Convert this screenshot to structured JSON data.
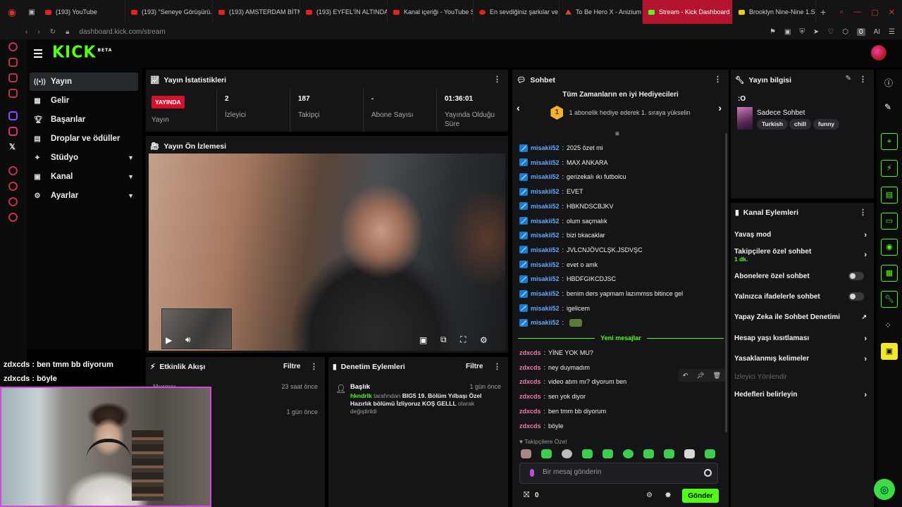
{
  "browser": {
    "tabs": [
      {
        "label": "(193) YouTube",
        "color": "#e62117"
      },
      {
        "label": "(193) \"Seneye Görüşürü...",
        "color": "#e62117"
      },
      {
        "label": "(193) AMSTERDAM BİTM...",
        "color": "#e62117"
      },
      {
        "label": "(193) EYFEL'İN ALTINDA...",
        "color": "#e62117"
      },
      {
        "label": "Kanal içeriği - YouTube S...",
        "color": "#e62117"
      },
      {
        "label": "En sevdiğiniz şarkılar ve...",
        "color": "#e62117"
      },
      {
        "label": "To Be Hero X - Anizium",
        "color": "#e64a19"
      },
      {
        "label": "Stream - Kick Dashboard",
        "color": "#53fc18"
      },
      {
        "label": "Brooklyn Nine-Nine 1.Se...",
        "color": "#f2c811"
      }
    ],
    "url": "dashboard.kick.com/stream",
    "ai_label": "AI",
    "ext_count": "0"
  },
  "header": {
    "logo": "KICK",
    "logo_beta": "BETA"
  },
  "nav": [
    {
      "label": "Yayın",
      "icon": "broadcast-icon"
    },
    {
      "label": "Gelir",
      "icon": "revenue-icon"
    },
    {
      "label": "Başarılar",
      "icon": "trophy-icon"
    },
    {
      "label": "Droplar ve ödüller",
      "icon": "drops-icon"
    },
    {
      "label": "Stüdyo",
      "icon": "studio-icon"
    },
    {
      "label": "Kanal",
      "icon": "channel-icon"
    },
    {
      "label": "Ayarlar",
      "icon": "settings-icon"
    }
  ],
  "stats": {
    "title": "Yayın İstatistikleri",
    "live_badge": "YAYINDA",
    "items": [
      {
        "value": "",
        "label": "Yayın"
      },
      {
        "value": "2",
        "label": "İzleyici"
      },
      {
        "value": "187",
        "label": "Takipçi"
      },
      {
        "value": "-",
        "label": "Abone Sayısı"
      },
      {
        "value": "01:36:01",
        "label": "Yayında Olduğu Süre"
      }
    ]
  },
  "preview": {
    "title": "Yayın Ön İzlemesi"
  },
  "activity": {
    "title": "Etkinlik Akışı",
    "filter": "Filtre",
    "entry_name": "Murovv",
    "times": [
      "23 saat önce",
      "1 gün önce"
    ]
  },
  "moderation": {
    "title": "Denetim Eylemleri",
    "filter": "Filtre",
    "entry_title": "Başlık",
    "entry_time": "1 gün önce",
    "entry_user": "hkndrlk",
    "entry_mid": "tarafından",
    "entry_value": "BIG5 19. Bölüm Yılbaşı Özel Hazırlık bölümü İzliyoruz KOŞ GELLL",
    "entry_suffix": "olarak değiştirildi"
  },
  "chat": {
    "title": "Sohbet",
    "leader_title": "Tüm Zamanların en iyi Hediyecileri",
    "leader_rank": "1",
    "leader_text": "1 abonelik hediye ederek 1. sıraya yükselin",
    "messages_old": [
      {
        "user": "misakii52",
        "text": "2025 özet mi"
      },
      {
        "user": "misakii52",
        "text": "MAX ANKARA"
      },
      {
        "user": "misakii52",
        "text": "gerizekalı ıkı futbolcu"
      },
      {
        "user": "misakii52",
        "text": "EVET"
      },
      {
        "user": "misakii52",
        "text": "HBKNDSCBJKV"
      },
      {
        "user": "misakii52",
        "text": "olum saçmalık"
      },
      {
        "user": "misakii52",
        "text": "bizi tıkacaklar"
      },
      {
        "user": "misakii52",
        "text": "JVLCNJÖVCLŞK.JSDVŞC"
      },
      {
        "user": "misakii52",
        "text": "evet o amk"
      },
      {
        "user": "misakii52",
        "text": "HBDFGIKCDJSC"
      },
      {
        "user": "misakii52",
        "text": "benim ders yapmam lazımmss bitince gel"
      },
      {
        "user": "misakii52",
        "text": "igelicem"
      },
      {
        "user": "misakii52",
        "text": ""
      }
    ],
    "new_label": "Yeni mesajlar",
    "messages_new": [
      {
        "user": "zdxcds",
        "text": "YİNE YOK MU?"
      },
      {
        "user": "zdxcds",
        "text": "ney duymadım"
      },
      {
        "user": "zdxcds",
        "text": "video atım mı? diyorum ben"
      },
      {
        "user": "zdxcds",
        "text": "sen yok diyor"
      },
      {
        "user": "zdxcds",
        "text": "ben tmm bb diyorum"
      },
      {
        "user": "zdxcds",
        "text": "böyle"
      }
    ],
    "followers_only": "Takipçilere Özel",
    "placeholder": "Bir mesaj gönderin",
    "points": "0",
    "send": "Gönder"
  },
  "stream_info": {
    "title": "Yayın bilgisi",
    "stream_title": ":O",
    "category": "Sadece Sohbet",
    "tags": [
      "Turkish",
      "chill",
      "funny"
    ]
  },
  "channel_actions": {
    "title": "Kanal Eylemleri",
    "items": [
      {
        "label": "Yavaş mod",
        "type": "chevron",
        "sub": ""
      },
      {
        "label": "Takipçilere özel sohbet",
        "type": "chevron",
        "sub": "1 dk."
      },
      {
        "label": "Abonelere özel sohbet",
        "type": "toggle",
        "sub": ""
      },
      {
        "label": "Yalnızca ifadelerle sohbet",
        "type": "toggle",
        "sub": ""
      },
      {
        "label": "Yapay Zeka ile Sohbet Denetimi",
        "type": "external",
        "sub": ""
      },
      {
        "label": "Hesap yaşı kısıtlaması",
        "type": "chevron",
        "sub": ""
      },
      {
        "label": "Yasaklanmış kelimeler",
        "type": "chevron",
        "sub": ""
      },
      {
        "label": "İzleyici Yönlendir",
        "type": "disabled",
        "sub": ""
      },
      {
        "label": "Hedefleri belirleyin",
        "type": "chevron",
        "sub": ""
      }
    ]
  },
  "overlay": {
    "line1_user": "zdxcds",
    "line1_text": ": ben tmm bb diyorum",
    "line2_user": "zdxcds",
    "line2_text": ": böyle"
  },
  "colors": {
    "kick_green": "#53fc18",
    "live_red": "#d3132c",
    "panel_bg": "#151517",
    "active_tab": "#b4142e",
    "cam_border": "#d24bd8"
  }
}
